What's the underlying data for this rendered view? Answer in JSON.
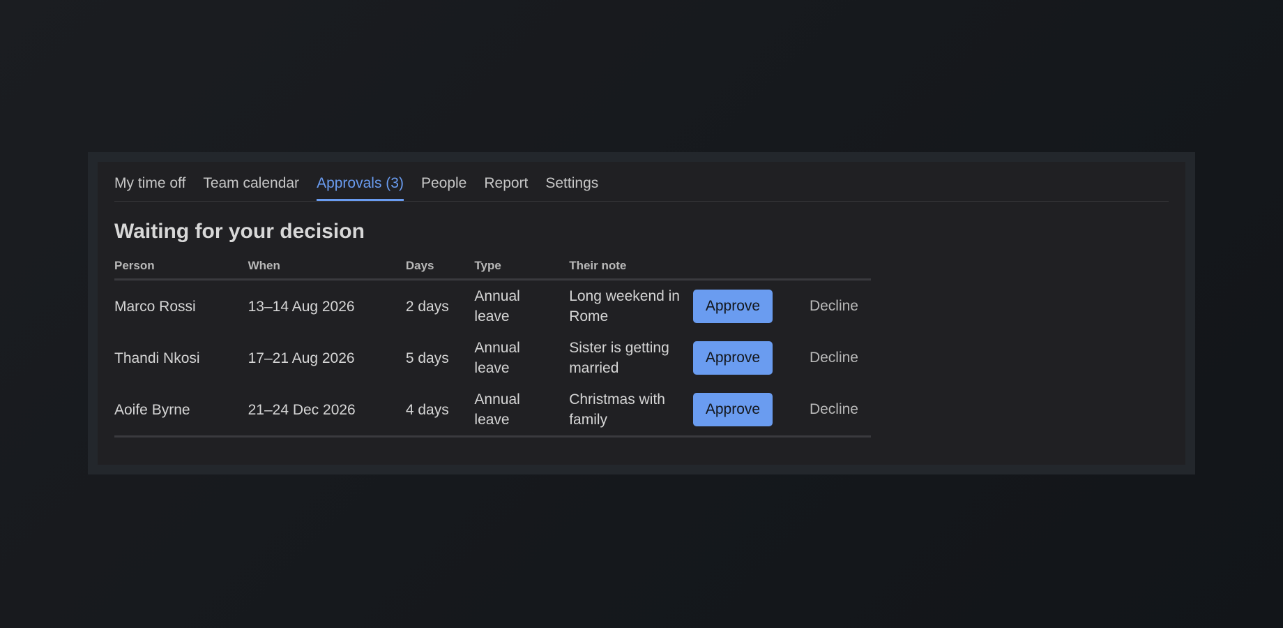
{
  "tabs": [
    {
      "label": "My time off",
      "active": false
    },
    {
      "label": "Team calendar",
      "active": false
    },
    {
      "label": "Approvals (3)",
      "active": true
    },
    {
      "label": "People",
      "active": false
    },
    {
      "label": "Report",
      "active": false
    },
    {
      "label": "Settings",
      "active": false
    }
  ],
  "heading": "Waiting for your decision",
  "columns": {
    "person": "Person",
    "when": "When",
    "days": "Days",
    "type": "Type",
    "note": "Their note"
  },
  "rows": [
    {
      "person": "Marco Rossi",
      "when": "13–14 Aug 2026",
      "days": "2 days",
      "type": "Annual leave",
      "note": "Long weekend in Rome",
      "approve": "Approve",
      "decline": "Decline"
    },
    {
      "person": "Thandi Nkosi",
      "when": "17–21 Aug 2026",
      "days": "5 days",
      "type": "Annual leave",
      "note": "Sister is getting married",
      "approve": "Approve",
      "decline": "Decline"
    },
    {
      "person": "Aoife Byrne",
      "when": "21–24 Dec 2026",
      "days": "4 days",
      "type": "Annual leave",
      "note": "Christmas with family",
      "approve": "Approve",
      "decline": "Decline"
    }
  ],
  "colors": {
    "accent": "#6a9cf0",
    "panel": "#202023",
    "background": "#15181c"
  }
}
